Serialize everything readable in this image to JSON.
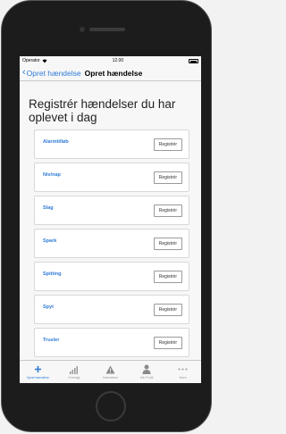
{
  "status_bar": {
    "carrier": "Operator",
    "time": "12.00"
  },
  "nav": {
    "back_label": "Opret hændelse",
    "title": "Opret hændelse"
  },
  "main": {
    "heading": "Registrér hændelser du har oplevet i dag",
    "rows": [
      {
        "label": "Alarmtilløb",
        "button": "Registrér"
      },
      {
        "label": "Niv/nap",
        "button": "Registrér"
      },
      {
        "label": "Slag",
        "button": "Registrér"
      },
      {
        "label": "Spark",
        "button": "Registrér"
      },
      {
        "label": "Spitting",
        "button": "Registrér"
      },
      {
        "label": "Spyt",
        "button": "Registrér"
      },
      {
        "label": "Trusler",
        "button": "Registrér"
      }
    ]
  },
  "tab_bar": {
    "active_color": "#2f7bd6",
    "tabs": [
      {
        "label": "Opret hændelse",
        "icon": "plus-icon"
      },
      {
        "label": "Oversigt",
        "icon": "bar-chart-icon"
      },
      {
        "label": "Hændelser",
        "icon": "warning-icon"
      },
      {
        "label": "Min Profil",
        "icon": "person-icon"
      },
      {
        "label": "More",
        "icon": "more-icon"
      }
    ]
  }
}
